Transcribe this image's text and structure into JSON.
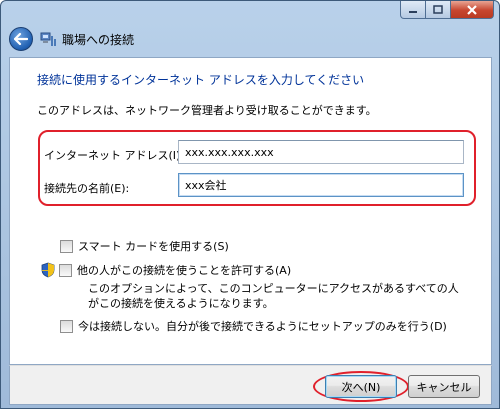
{
  "window": {
    "title": "職場への接続"
  },
  "content": {
    "heading": "接続に使用するインターネット アドレスを入力してください",
    "description": "このアドレスは、ネットワーク管理者より受け取ることができます。"
  },
  "fields": {
    "address_label": "インターネット アドレス(I):",
    "address_value": "xxx.xxx.xxx.xxx",
    "name_label": "接続先の名前(E):",
    "name_value": "xxx会社"
  },
  "options": {
    "smartcard_label": "スマート カードを使用する(S)",
    "allow_others_label": "他の人がこの接続を使うことを許可する(A)",
    "allow_others_note_line1": "このオプションによって、このコンピューターにアクセスがあるすべての人",
    "allow_others_note_line2": "がこの接続を使えるようになります。",
    "dont_connect_label": "今は接続しない。自分が後で接続できるようにセットアップのみを行う(D)"
  },
  "buttons": {
    "next_label": "次へ(N)",
    "cancel_label": "キャンセル"
  },
  "icons": {
    "back": "back-arrow-icon",
    "network": "network-connection-icon",
    "shield": "uac-shield-icon"
  },
  "colors": {
    "heading": "#003399",
    "highlight_annotation": "#e0202b"
  }
}
